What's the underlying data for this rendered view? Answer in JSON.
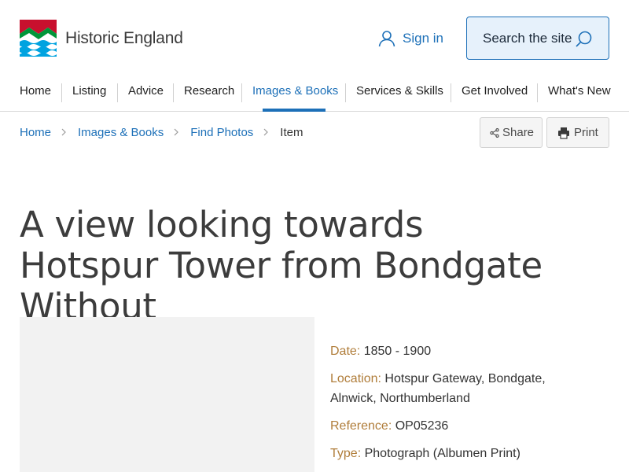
{
  "header": {
    "logo_text": "Historic England",
    "signin_label": "Sign in",
    "search_label": "Search the site"
  },
  "nav": {
    "items": [
      {
        "label": "Home"
      },
      {
        "label": "Listing"
      },
      {
        "label": "Advice"
      },
      {
        "label": "Research"
      },
      {
        "label": "Images & Books"
      },
      {
        "label": "Services & Skills"
      },
      {
        "label": "Get Involved"
      },
      {
        "label": "What's New"
      }
    ],
    "active": "Images & Books"
  },
  "breadcrumb": {
    "items": [
      "Home",
      "Images & Books",
      "Find Photos"
    ],
    "current": "Item"
  },
  "actions": {
    "share_label": "Share",
    "print_label": "Print"
  },
  "page": {
    "title": "A view looking towards Hotspur Tower from Bondgate Without"
  },
  "details": {
    "date_label": "Date:",
    "date_value": "1850 - 1900",
    "location_label": "Location:",
    "location_value": "Hotspur Gateway, Bondgate, Alnwick, Northumberland",
    "reference_label": "Reference:",
    "reference_value": "OP05236",
    "type_label": "Type:",
    "type_value": "Photograph (Albumen Print)"
  },
  "colors": {
    "accent": "#1d70b8",
    "label": "#b07d3a",
    "search_bg": "#e6f1fb"
  },
  "icons": {
    "logo": "historic-england-logo-icon",
    "user": "user-icon",
    "search": "search-icon",
    "chevron": "chevron-right-icon",
    "share": "share-icon",
    "print": "print-icon"
  }
}
